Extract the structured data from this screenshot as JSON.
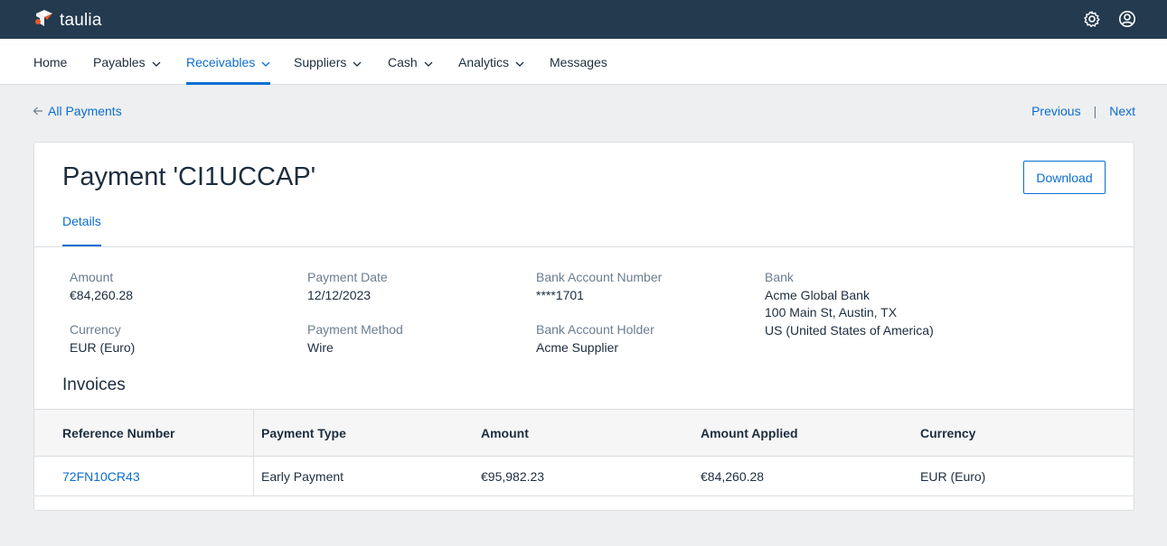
{
  "app": {
    "brand": "taulia",
    "brand_color": "#233a4f",
    "accent_color": "#0a6ed1",
    "header_icons": [
      "gear-icon",
      "user-profile-icon"
    ]
  },
  "nav": {
    "items": [
      {
        "label": "Home",
        "has_dropdown": false,
        "active": false
      },
      {
        "label": "Payables",
        "has_dropdown": true,
        "active": false
      },
      {
        "label": "Receivables",
        "has_dropdown": true,
        "active": true
      },
      {
        "label": "Suppliers",
        "has_dropdown": true,
        "active": false
      },
      {
        "label": "Cash",
        "has_dropdown": true,
        "active": false
      },
      {
        "label": "Analytics",
        "has_dropdown": true,
        "active": false
      },
      {
        "label": "Messages",
        "has_dropdown": false,
        "active": false
      }
    ]
  },
  "breadcrumb": {
    "back_label": "All Payments"
  },
  "pager": {
    "previous_label": "Previous",
    "separator": "|",
    "next_label": "Next"
  },
  "payment": {
    "title": "Payment 'CI1UCCAP'",
    "download_label": "Download",
    "tab_label": "Details",
    "fields": {
      "amount": {
        "label": "Amount",
        "value": "€84,260.28"
      },
      "currency": {
        "label": "Currency",
        "value": "EUR (Euro)"
      },
      "payment_date": {
        "label": "Payment Date",
        "value": "12/12/2023"
      },
      "payment_method": {
        "label": "Payment Method",
        "value": "Wire"
      },
      "bank_account_number": {
        "label": "Bank Account Number",
        "value": "****1701"
      },
      "bank_account_holder": {
        "label": "Bank Account Holder",
        "value": "Acme Supplier"
      },
      "bank": {
        "label": "Bank",
        "line1": "Acme Global Bank",
        "line2": "100 Main St, Austin, TX",
        "line3": "US (United States of America)"
      }
    }
  },
  "invoices": {
    "heading": "Invoices",
    "columns": [
      "Reference Number",
      "Payment Type",
      "Amount",
      "Amount Applied",
      "Currency"
    ],
    "rows": [
      [
        "72FN10CR43",
        "Early Payment",
        "€95,982.23",
        "€84,260.28",
        "EUR (Euro)"
      ]
    ]
  }
}
